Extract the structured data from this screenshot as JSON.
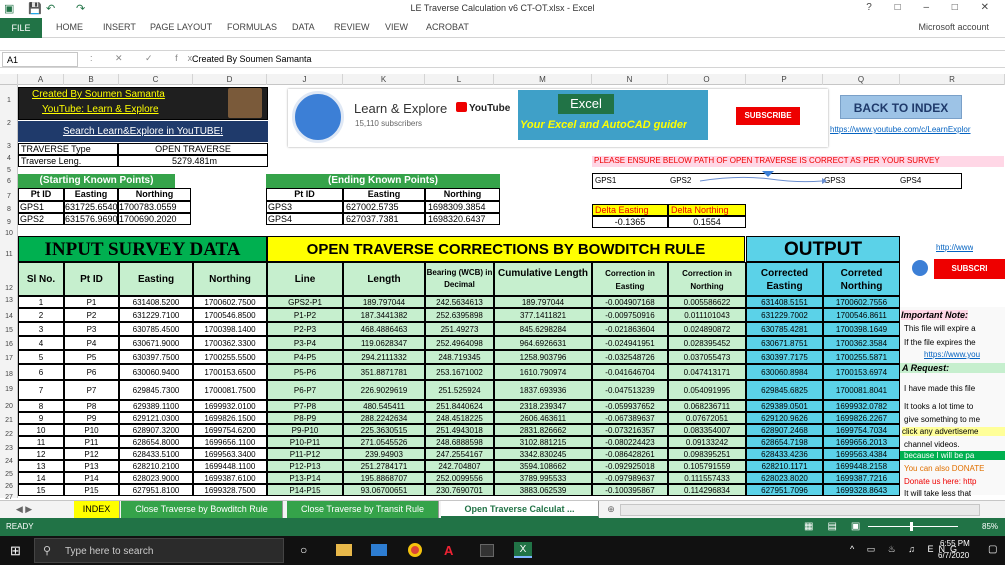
{
  "window": {
    "title": "LE Traverse Calculation v6 CT-OT.xlsx - Excel"
  },
  "ribbon": {
    "tabs": [
      "FILE",
      "HOME",
      "INSERT",
      "PAGE LAYOUT",
      "FORMULAS",
      "DATA",
      "REVIEW",
      "VIEW",
      "ACROBAT"
    ],
    "account": "Microsoft account"
  },
  "formula_bar": {
    "name_box": "A1",
    "content": "Created By Soumen Samanta"
  },
  "columns": [
    "A",
    "B",
    "C",
    "D",
    "J",
    "K",
    "L",
    "M",
    "N",
    "O",
    "P",
    "Q",
    "R"
  ],
  "rows": [
    "1",
    "2",
    "3",
    "4",
    "5",
    "6",
    "7",
    "8",
    "9",
    "10",
    "11",
    "12",
    "13",
    "14",
    "15",
    "16",
    "17",
    "18",
    "19",
    "20",
    "21",
    "22",
    "23",
    "24",
    "25",
    "26",
    "27"
  ],
  "header_block": {
    "created_by": "Created By Soumen Samanta",
    "youtube_line": "YouTube: Learn & Explore",
    "search_line": "Search Learn&Explore in YouTUBE!",
    "traverse_type_label": "TRAVERSE Type",
    "traverse_type_value": "OPEN TRAVERSE",
    "traverse_length_label": "Traverse Leng.",
    "traverse_length_value": "5279.481m"
  },
  "channel": {
    "name": "Learn & Explore",
    "subs": "15,110 subscribers",
    "yt": "YouTube",
    "banner": "Your Excel and AutoCAD guider",
    "excel": "Excel",
    "subscribe": "SUBSCRIBE"
  },
  "back_button": "BACK TO INDEX",
  "channel_url": "https://www.youtube.com/c/LearnExplor",
  "path_note": "PLEASE ENSURE BELOW PATH OF OPEN TRAVERSE IS CORRECT AS PER YOUR SURVEY",
  "path": [
    "GPS1",
    "GPS2",
    "GPS3",
    "GPS4"
  ],
  "start_points": {
    "title": "(Starting Known Points)",
    "headers": [
      "Pt ID",
      "Easting",
      "Northing"
    ],
    "rows": [
      [
        "GPS1",
        "631725.6540",
        "1700783.0559"
      ],
      [
        "GPS2",
        "631576.9690",
        "1700690.2020"
      ]
    ]
  },
  "end_points": {
    "title": "(Ending Known Points)",
    "headers": [
      "Pt ID",
      "Easting",
      "Northing"
    ],
    "rows": [
      [
        "GPS3",
        "627002.5735",
        "1698309.3854"
      ],
      [
        "GPS4",
        "627037.7381",
        "1698320.6437"
      ]
    ]
  },
  "delta": {
    "e_label": "Delta Easting",
    "n_label": "Delta Northing",
    "e": "-0.1365",
    "n": "0.1554"
  },
  "titles": {
    "input": "INPUT SURVEY DATA",
    "corrections": "OPEN TRAVERSE CORRECTIONS BY BOWDITCH RULE",
    "output": "OUTPUT",
    "url_short": "http://www",
    "subscribe2": "SUBSCRI"
  },
  "table_headers": [
    "Sl No.",
    "Pt ID",
    "Easting",
    "Northing",
    "Line",
    "Length",
    "Bearing (WCB) in Decimal",
    "Cumulative Length",
    "Correction in Easting",
    "Correction in Northing",
    "Corrected Easting",
    "Correted Northing"
  ],
  "table_rows": [
    [
      "1",
      "P1",
      "631408.5200",
      "1700602.7500",
      "GPS2-P1",
      "189.797044",
      "242.5634613",
      "189.797044",
      "-0.004907168",
      "0.005586622",
      "631408.5151",
      "1700602.7556"
    ],
    [
      "2",
      "P2",
      "631229.7100",
      "1700546.8500",
      "P1-P2",
      "187.3441382",
      "252.6395898",
      "377.1411821",
      "-0.009750916",
      "0.011101043",
      "631229.7002",
      "1700546.8611"
    ],
    [
      "3",
      "P3",
      "630785.4500",
      "1700398.1400",
      "P2-P3",
      "468.4886463",
      "251.49273",
      "845.6298284",
      "-0.021863604",
      "0.024890872",
      "630785.4281",
      "1700398.1649"
    ],
    [
      "4",
      "P4",
      "630671.9000",
      "1700362.3300",
      "P3-P4",
      "119.0628347",
      "252.4964098",
      "964.6926631",
      "-0.024941951",
      "0.028395452",
      "630671.8751",
      "1700362.3584"
    ],
    [
      "5",
      "P5",
      "630397.7500",
      "1700255.5500",
      "P4-P5",
      "294.2111332",
      "248.719345",
      "1258.903796",
      "-0.032548726",
      "0.037055473",
      "630397.7175",
      "1700255.5871"
    ],
    [
      "6",
      "P6",
      "630060.9400",
      "1700153.6500",
      "P5-P6",
      "351.8871781",
      "253.1671002",
      "1610.790974",
      "-0.041646704",
      "0.047413171",
      "630060.8984",
      "1700153.6974"
    ],
    [
      "7",
      "P7",
      "629845.7300",
      "1700081.7500",
      "P6-P7",
      "226.9029619",
      "251.525924",
      "1837.693936",
      "-0.047513239",
      "0.054091995",
      "629845.6825",
      "1700081.8041"
    ],
    [
      "8",
      "P8",
      "629389.1100",
      "1699932.0100",
      "P7-P8",
      "480.545411",
      "251.8440624",
      "2318.239347",
      "-0.059937652",
      "0.068236711",
      "629389.0501",
      "1699932.0782"
    ],
    [
      "9",
      "P9",
      "629121.0300",
      "1699826.1500",
      "P8-P9",
      "288.2242634",
      "248.4518225",
      "2606.463611",
      "-0.067389637",
      "0.07672051",
      "629120.9626",
      "1699826.2267"
    ],
    [
      "10",
      "P10",
      "628907.3200",
      "1699754.6200",
      "P9-P10",
      "225.3630515",
      "251.4943018",
      "2831.826662",
      "-0.073216357",
      "0.083354007",
      "628907.2468",
      "1699754.7034"
    ],
    [
      "11",
      "P11",
      "628654.8000",
      "1699656.1100",
      "P10-P11",
      "271.0545526",
      "248.6888598",
      "3102.881215",
      "-0.080224423",
      "0.09133242",
      "628654.7198",
      "1699656.2013"
    ],
    [
      "12",
      "P12",
      "628433.5100",
      "1699563.3400",
      "P11-P12",
      "239.94903",
      "247.2554167",
      "3342.830245",
      "-0.086428261",
      "0.098395251",
      "628433.4236",
      "1699563.4384"
    ],
    [
      "13",
      "P13",
      "628210.2100",
      "1699448.1100",
      "P12-P13",
      "251.2784171",
      "242.704807",
      "3594.108662",
      "-0.092925018",
      "0.105791559",
      "628210.1171",
      "1699448.2158"
    ],
    [
      "14",
      "P14",
      "628023.9000",
      "1699387.6100",
      "P13-P14",
      "195.8868707",
      "252.0099556",
      "3789.995533",
      "-0.097989637",
      "0.111557433",
      "628023.8020",
      "1699387.7216"
    ],
    [
      "15",
      "P15",
      "627951.8100",
      "1699328.7500",
      "P14-P15",
      "93.06700651",
      "230.7690701",
      "3883.062539",
      "-0.100395867",
      "0.114296834",
      "627951.7096",
      "1699328.8643"
    ]
  ],
  "side_notes": [
    "Important Note:",
    "This file will expire a",
    "If the file expires the",
    "https://www.you",
    "A Request:",
    "I have made this file",
    "It tooks a lot time to",
    "give something to me",
    "click any advertiseme",
    "channel videos.",
    "because I will be pa",
    "You can also DONATE",
    "Donate us here: http",
    "It will take less that"
  ],
  "sheet_tabs": [
    "INDEX",
    "Close Traverse by Bowditch Rule",
    "Close Traverse by Transit Rule",
    "Open Traverse Calculat ..."
  ],
  "status": {
    "ready": "READY",
    "zoom": "85%"
  },
  "taskbar": {
    "search": "Type here to search",
    "time": "6:55 PM",
    "date": "6/7/2020"
  },
  "colors": {
    "excel_green": "#217346",
    "header_green": "#35a34a",
    "light_green": "#c6efce",
    "yellow": "#ffff00",
    "cyan": "#5bd2e8"
  }
}
